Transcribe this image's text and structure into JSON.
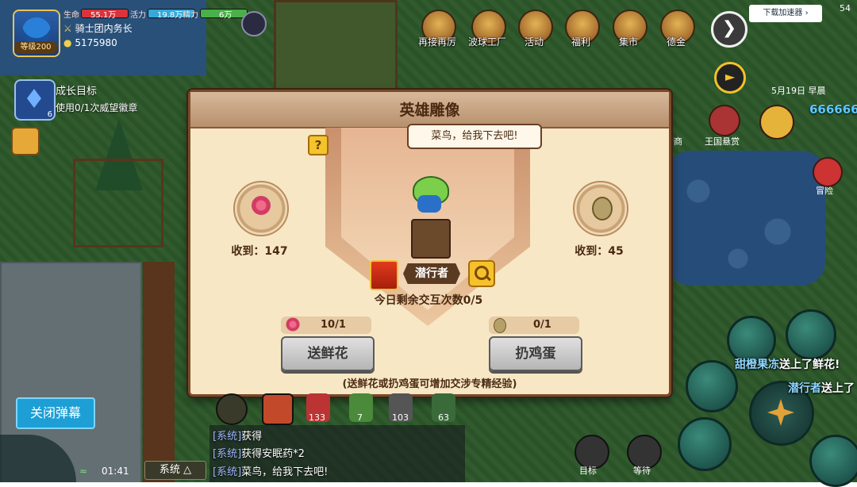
{
  "hud": {
    "level": "等级200",
    "stats": [
      {
        "label": "生命",
        "value": "55.1万",
        "fill": 1.0,
        "color": "#d9343b"
      },
      {
        "label": "活力",
        "value": "19.8万",
        "fill": 1.0,
        "color": "#36a9d8"
      },
      {
        "label": "精力",
        "value": "6万",
        "fill": 1.0,
        "color": "#4ab04a"
      }
    ],
    "title": "骑士团内务长",
    "gold": "5175980",
    "growth_title": "成长目标",
    "growth_desc": "使用0/1次威望徽章",
    "growth_badge": "6"
  },
  "top_menu": [
    {
      "label": "再接再厉",
      "icon": "shop-icon"
    },
    {
      "label": "波球工厂",
      "icon": "factory-icon"
    },
    {
      "label": "活动",
      "icon": "event-icon"
    },
    {
      "label": "福利",
      "icon": "gift-icon"
    },
    {
      "label": "集市",
      "icon": "market-icon"
    },
    {
      "label": "德金",
      "icon": "scale-icon"
    }
  ],
  "right_hud": {
    "download_label": "下载加速器",
    "badge_num": "54",
    "date": "5月19日",
    "time_of_day": "早晨",
    "score": "666666",
    "side_labels": [
      "行商",
      "王国悬赏",
      "冒险"
    ]
  },
  "dialog": {
    "title": "英雄雕像",
    "speech": "菜鸟，给我下去吧!",
    "help": "?",
    "left_collected": "收到：147",
    "right_collected": "收到：45",
    "statue_name": "潜行者",
    "interact_count": "今日剩余交互次数0/5",
    "flower_count": "10/1",
    "egg_count": "0/1",
    "send_flower": "送鲜花",
    "throw_egg": "扔鸡蛋",
    "footnote": "(送鲜花或扔鸡蛋可增加交涉专精经验)"
  },
  "bottom": {
    "close_danmu": "关闭弹幕",
    "time": "01:41",
    "chat_channel": "系统",
    "chat_lines": [
      {
        "tag": "[系统]",
        "text": "获得"
      },
      {
        "tag": "[系统]",
        "text": "获得安眠药*2"
      },
      {
        "tag": "[系统]",
        "text": "菜鸟，给我下去吧!"
      }
    ],
    "item_counts": [
      "133",
      "7",
      "103",
      "63"
    ],
    "bottom_labels": [
      "目标",
      "等待"
    ]
  },
  "danmu": [
    {
      "name": "甜橙果冻",
      "text": "送上了鲜花!"
    },
    {
      "name": "潜行者",
      "text": "送上了"
    }
  ]
}
